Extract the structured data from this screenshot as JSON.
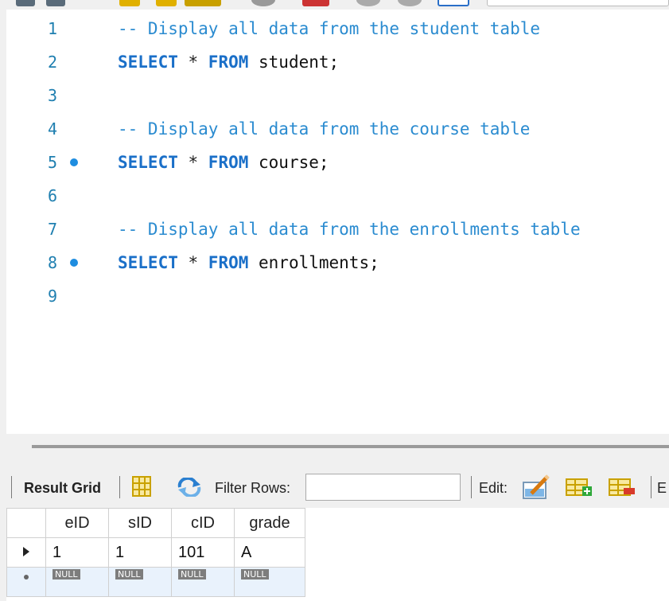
{
  "editor": {
    "lines": [
      {
        "num": "1",
        "text": "-- Display all data from the student table",
        "kind": "comment",
        "marker": false
      },
      {
        "num": "2",
        "kw1": "SELECT",
        "op": " * ",
        "kw2": "FROM",
        "rest": " student;",
        "kind": "sql",
        "marker": false
      },
      {
        "num": "3",
        "text": "",
        "kind": "blank",
        "marker": false
      },
      {
        "num": "4",
        "text": "-- Display all data from the course table",
        "kind": "comment",
        "marker": false
      },
      {
        "num": "5",
        "kw1": "SELECT",
        "op": " * ",
        "kw2": "FROM",
        "rest": " course;",
        "kind": "sql",
        "marker": true
      },
      {
        "num": "6",
        "text": "",
        "kind": "blank",
        "marker": false
      },
      {
        "num": "7",
        "text": "-- Display all data from the enrollments table",
        "kind": "comment",
        "marker": false
      },
      {
        "num": "8",
        "kw1": "SELECT",
        "op": " * ",
        "kw2": "FROM",
        "rest": " enrollments;",
        "kind": "sql",
        "marker": true
      },
      {
        "num": "9",
        "text": "",
        "kind": "blank",
        "marker": false
      }
    ]
  },
  "result_toolbar": {
    "result_grid_label": "Result Grid",
    "filter_label": "Filter Rows:",
    "filter_value": "",
    "edit_label": "Edit:",
    "export_label": "E"
  },
  "grid": {
    "columns": [
      "eID",
      "sID",
      "cID",
      "grade"
    ],
    "rows": [
      [
        "1",
        "1",
        "101",
        "A"
      ]
    ],
    "null_label": "NULL"
  },
  "colors": {
    "comment": "#2a8bd0",
    "keyword": "#1a6fc8",
    "line_number": "#1f7fb0",
    "marker": "#1e8de0"
  }
}
